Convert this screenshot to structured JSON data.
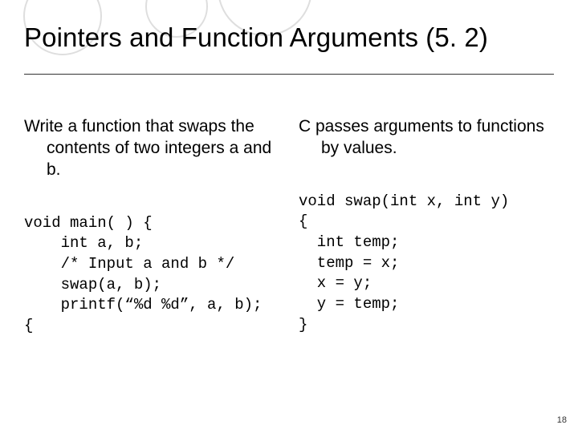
{
  "slide": {
    "title": "Pointers and Function Arguments (5. 2)",
    "page_number": "18"
  },
  "left": {
    "para": "Write a function that swaps the contents of two integers a and b.",
    "code": "void main( ) {\n    int a, b;\n    /* Input a and b */\n    swap(a, b);\n    printf(“%d %d”, a, b);\n{"
  },
  "right": {
    "para": "C passes arguments to functions by values.",
    "code": "void swap(int x, int y)\n{\n  int temp;\n  temp = x;\n  x = y;\n  y = temp;\n}"
  }
}
